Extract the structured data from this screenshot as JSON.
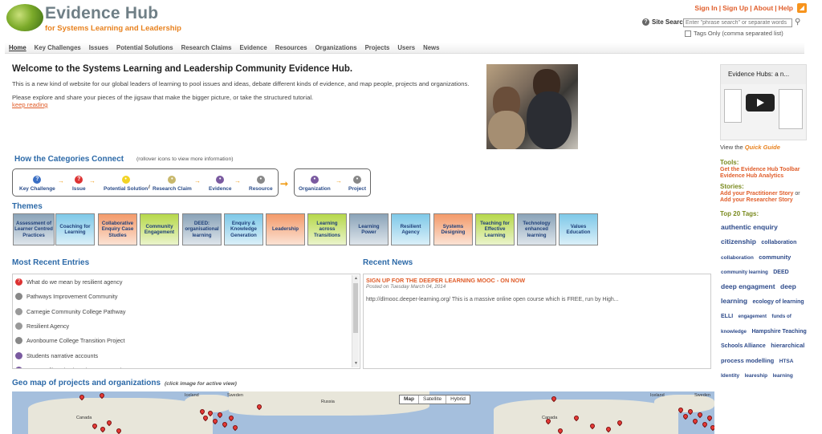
{
  "header": {
    "logo_title": "Evidence Hub",
    "logo_subtitle": "for Systems Learning and Leadership",
    "top_links": [
      "Sign In",
      "Sign Up",
      "About",
      "Help"
    ],
    "search_label": "Site Search",
    "search_placeholder": "Enter \"phrase search\" or separate words",
    "tags_only_label": "Tags Only (comma separated list)"
  },
  "nav": {
    "items": [
      "Home",
      "Key Challenges",
      "Issues",
      "Potential Solutions",
      "Research Claims",
      "Evidence",
      "Resources",
      "Organizations",
      "Projects",
      "Users",
      "News"
    ]
  },
  "welcome": {
    "title": "Welcome to the Systems Learning and Leadership Community Evidence Hub.",
    "p1": "This is a new kind of website for our global leaders of learning to pool issues and ideas, debate different kinds of evidence, and map people, projects and organizations.",
    "p2": "Please explore and share your pieces of the jigsaw that make the bigger picture, or take the structured tutorial.",
    "keep_reading": "keep reading"
  },
  "categories": {
    "title": "How the Categories Connect",
    "hint": "(rollover icons to view more information)",
    "items": [
      "Key Challenge",
      "Issue",
      "Potential Solution",
      "Research Claim",
      "Evidence",
      "Resource",
      "Organization",
      "Project"
    ],
    "slash": "/"
  },
  "themes": {
    "title": "Themes",
    "items": [
      {
        "label": "Assessment of Learner Centred Practices",
        "color": "#8aa3b8"
      },
      {
        "label": "Coaching for Learning",
        "color": "#7ec8e8"
      },
      {
        "label": "Collaborative Enquiry Case Studies",
        "color": "#f39a6a"
      },
      {
        "label": "Community Engagement",
        "color": "#b6d84a"
      },
      {
        "label": "DEED: organisational learning",
        "color": "#8aa3b8"
      },
      {
        "label": "Enquiry & Knowledge Generation",
        "color": "#7ec8e8"
      },
      {
        "label": "Leadership",
        "color": "#f39a6a"
      },
      {
        "label": "Learning across Transitions",
        "color": "#b6d84a"
      },
      {
        "label": "Learning Power",
        "color": "#8aa3b8"
      },
      {
        "label": "Resilient Agency",
        "color": "#7ec8e8"
      },
      {
        "label": "Systems Designing",
        "color": "#f39a6a"
      },
      {
        "label": "Teaching for Effective Learning",
        "color": "#b6d84a"
      },
      {
        "label": "Technology enhanced learning",
        "color": "#8aa3b8"
      },
      {
        "label": "Values Education",
        "color": "#7ec8e8"
      }
    ]
  },
  "recent_entries": {
    "title": "Most Recent Entries",
    "items": [
      {
        "label": "What do we mean by resilient agency",
        "icon": "question-icon",
        "color": "#d33"
      },
      {
        "label": "Pathways Improvement Community",
        "icon": "project-icon",
        "color": "#888"
      },
      {
        "label": "Carnegie Community College Pathway",
        "icon": "organization-icon",
        "color": "#999"
      },
      {
        "label": "Resilient Agency",
        "icon": "organization-icon",
        "color": "#999"
      },
      {
        "label": "Avonbourne College Transition Project",
        "icon": "project-icon",
        "color": "#888"
      },
      {
        "label": "Students narrative accounts",
        "icon": "evidence-icon",
        "color": "#7a5aa0"
      },
      {
        "label": "ELLI Profiles plus learning conversations",
        "icon": "evidence-icon",
        "color": "#7a5aa0"
      }
    ]
  },
  "recent_news": {
    "title": "Recent News",
    "headline": "SIGN UP FOR THE DEEPER LEARNING MOOC - ON NOW",
    "date": "Posted on Tuesday March 04, 2014",
    "body": "http://dlmooc.deeper-learning.org/ This is a massive online open course which is FREE, run by High..."
  },
  "geo_map": {
    "title": "Geo map of projects and organizations",
    "hint": "(click image for active view)",
    "buttons": [
      "Map",
      "Satellite",
      "Hybrid"
    ],
    "labels": [
      "Iceland",
      "Sweden",
      "Russia",
      "Canada",
      "Iceland",
      "Sweden",
      "Canada"
    ]
  },
  "sidebar": {
    "video_title": "Evidence Hubs: a n...",
    "view_guide_prefix": "View the",
    "view_guide_link": "Quick Guide",
    "tools_title": "Tools:",
    "tools_links": [
      "Get the Evidence Hub Toolbar",
      "Evidence Hub Analytics"
    ],
    "stories_title": "Stories:",
    "stories_links": [
      "Add your Practitioner Story",
      "Add your Researcher Story"
    ],
    "or_text": "or",
    "tags_title": "Top 20 Tags:",
    "tags": [
      {
        "t": "authentic enquiry",
        "s": 8.5
      },
      {
        "t": "citizenship",
        "s": 8.5
      },
      {
        "t": "collaboration",
        "s": 7
      },
      {
        "t": "collaboration",
        "s": 6.5
      },
      {
        "t": "community",
        "s": 7.5
      },
      {
        "t": "community learning",
        "s": 6.2
      },
      {
        "t": "DEED",
        "s": 7
      },
      {
        "t": "deep engagment",
        "s": 8.5
      },
      {
        "t": "deep learning",
        "s": 8.5
      },
      {
        "t": "ecology of learning",
        "s": 7
      },
      {
        "t": "ELLI",
        "s": 7
      },
      {
        "t": "engagement",
        "s": 6
      },
      {
        "t": "funds of knowledge",
        "s": 6.2
      },
      {
        "t": "Hampshire Teaching Schools Alliance",
        "s": 7
      },
      {
        "t": "hierarchical process modelling",
        "s": 7.5
      },
      {
        "t": "HTSA",
        "s": 6.5
      },
      {
        "t": "Identity",
        "s": 6.5
      },
      {
        "t": "leareship",
        "s": 6.5
      },
      {
        "t": "learning",
        "s": 6.5
      }
    ]
  }
}
